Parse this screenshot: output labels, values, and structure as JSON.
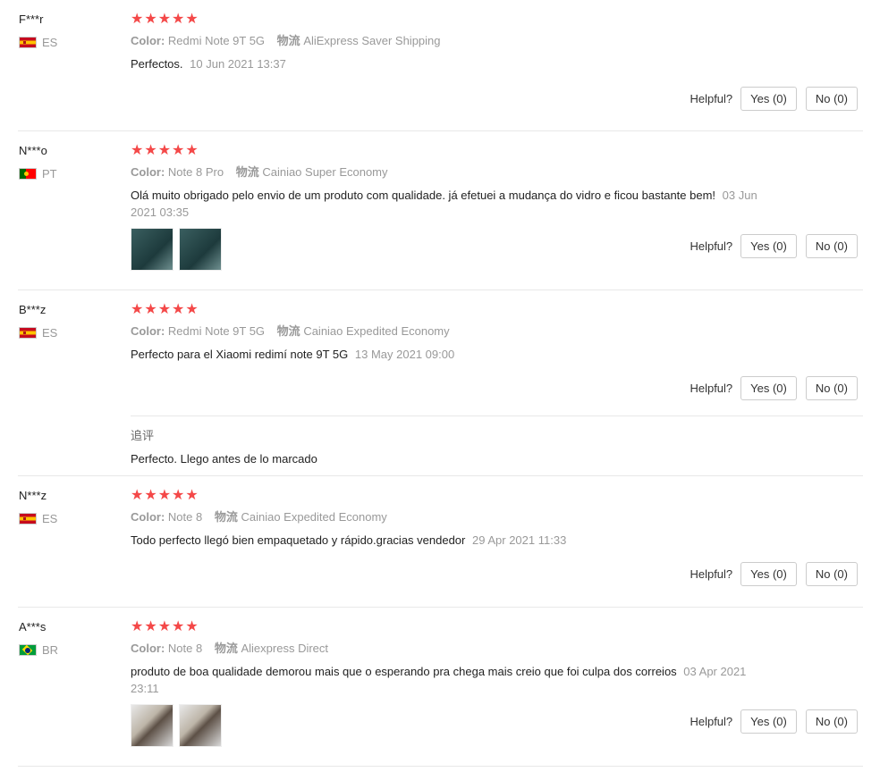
{
  "helpful_label": "Helpful?",
  "color_label": "Color:",
  "shipping_label": "物流",
  "reviews": [
    {
      "user": "F***r",
      "country": "ES",
      "stars": "★★★★★",
      "color": "Redmi Note 9T 5G",
      "shipping": "AliExpress Saver Shipping",
      "text": "Perfectos.",
      "date": "10 Jun 2021 13:37",
      "yes": "Yes (0)",
      "no": "No (0)"
    },
    {
      "user": "N***o",
      "country": "PT",
      "stars": "★★★★★",
      "color": "Note 8 Pro",
      "shipping": "Cainiao Super Economy",
      "text": "Olá muito obrigado pelo envio de um produto com qualidade. já efetuei a mudança do vidro e ficou bastante bem!",
      "date": "03 Jun 2021 03:35",
      "yes": "Yes (0)",
      "no": "No (0)"
    },
    {
      "user": "B***z",
      "country": "ES",
      "stars": "★★★★★",
      "color": "Redmi Note 9T 5G",
      "shipping": "Cainiao Expedited Economy",
      "text": "Perfecto para el Xiaomi redimí note 9T 5G",
      "date": "13 May 2021 09:00",
      "yes": "Yes (0)",
      "no": "No (0)",
      "followup_title": "追评",
      "followup_text": "Perfecto. Llego antes de lo marcado"
    },
    {
      "user": "N***z",
      "country": "ES",
      "stars": "★★★★★",
      "color": "Note 8",
      "shipping": "Cainiao Expedited Economy",
      "text": "Todo perfecto llegó bien empaquetado y rápido.gracias vendedor",
      "date": "29 Apr 2021 11:33",
      "yes": "Yes (0)",
      "no": "No (0)"
    },
    {
      "user": "A***s",
      "country": "BR",
      "stars": "★★★★★",
      "color": "Note 8",
      "shipping": "Aliexpress Direct",
      "text": "produto de boa qualidade demorou mais que o esperando pra chega mais creio que foi culpa dos correios",
      "date": "03 Apr 2021 23:11",
      "yes": "Yes (0)",
      "no": "No (0)"
    }
  ]
}
